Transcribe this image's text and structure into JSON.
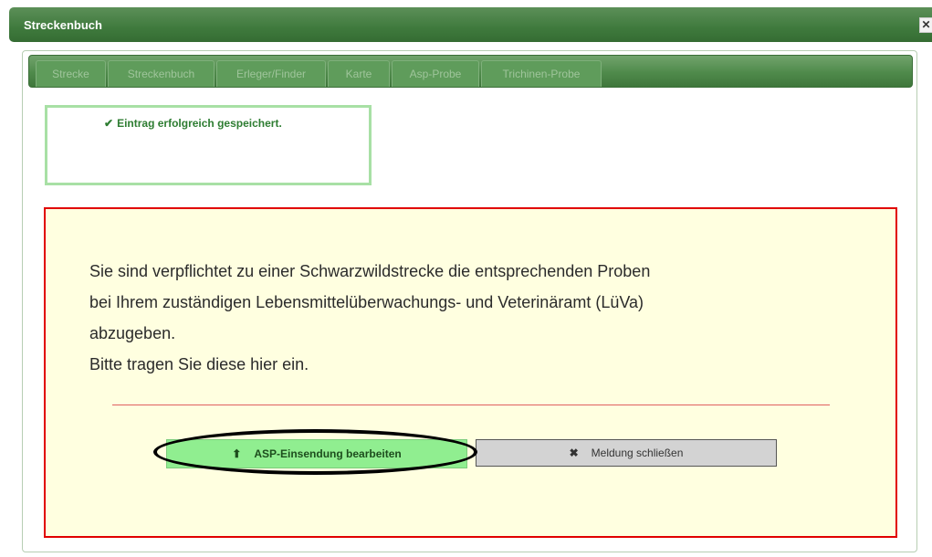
{
  "window": {
    "title": "Streckenbuch",
    "close_symbol": "✕"
  },
  "tabs": [
    {
      "label": "Strecke"
    },
    {
      "label": "Streckenbuch"
    },
    {
      "label": "Erleger/Finder"
    },
    {
      "label": "Karte"
    },
    {
      "label": "Asp-Probe"
    },
    {
      "label": "Trichinen-Probe"
    }
  ],
  "success": {
    "icon": "check-icon",
    "message": "Eintrag erfolgreich gespeichert."
  },
  "notice": {
    "lines": [
      "Sie sind verpflichtet zu einer Schwarzwildstrecke die entsprechenden Proben",
      "bei Ihrem zuständigen Lebensmittelüberwachungs- und Veterinäramt (LüVa)",
      "abzugeben.",
      "Bitte tragen Sie diese hier ein."
    ]
  },
  "buttons": {
    "asp_edit": {
      "label": "ASP-Einsendung bearbeiten",
      "icon": "upload-icon"
    },
    "close_message": {
      "label": "Meldung schließen",
      "icon": "close-icon"
    }
  },
  "colors": {
    "title_green": "#3f7a3d",
    "success_border": "#a8e0a5",
    "success_text": "#2e7d32",
    "notice_border": "#e10000",
    "notice_bg": "#ffffe0",
    "asp_button": "#90ee90",
    "close_button": "#d3d3d3"
  }
}
